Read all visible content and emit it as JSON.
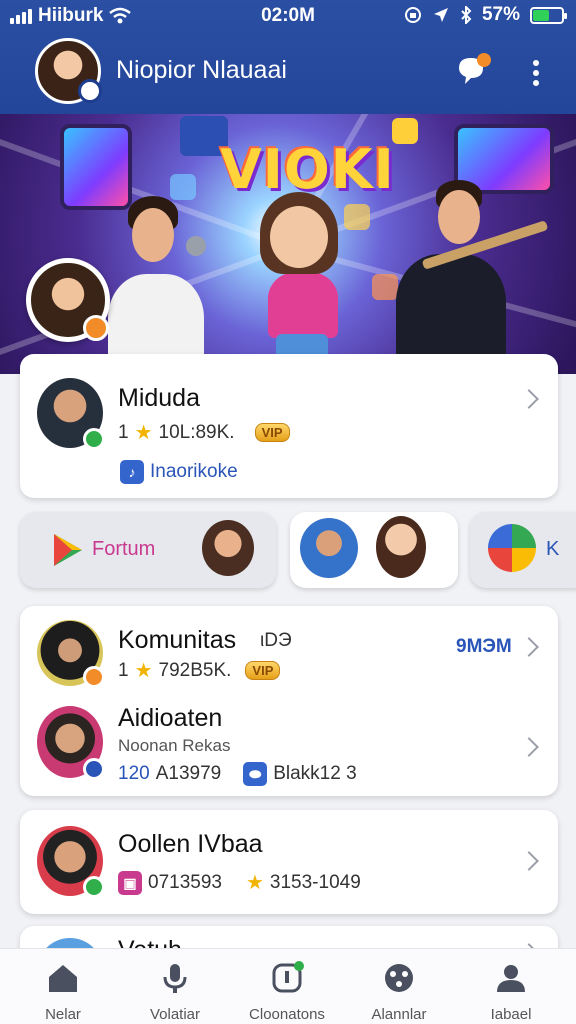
{
  "status_bar": {
    "carrier": "Hiiburk",
    "time": "02:0M",
    "battery": "57%",
    "icons": [
      "signal-icon",
      "wifi-icon",
      "rotation-lock-icon",
      "location-icon",
      "bluetooth-icon",
      "battery-icon"
    ]
  },
  "header": {
    "title": "Niopior Nlauaai",
    "icons": [
      "chat-bubble-icon",
      "more-vert-icon"
    ]
  },
  "banner": {
    "title": "VIOKI"
  },
  "featured": {
    "name": "Miduda",
    "stat": "1",
    "stat_value": "10L:89K.",
    "vip": "VIP",
    "tag": "Inaorikoke"
  },
  "chips": [
    {
      "label": "Fortum",
      "icon": "play-store-icon"
    },
    {
      "label": ""
    },
    {
      "label": "K",
      "icon": "play-store-icon"
    }
  ],
  "list_card_1": {
    "items": [
      {
        "name": "Komunitas",
        "suffix": "ιDЭ",
        "stat": "1",
        "stat_value": "792B5K.",
        "vip": "VIP",
        "right_label": "9MЭM"
      },
      {
        "name": "Aidioaten",
        "subtitle": "Noonan Rekas",
        "count": "120",
        "count_value": "A13979",
        "tag_value": "Blakk12 3"
      }
    ]
  },
  "list_card_2": {
    "name": "Oollen IVbaa",
    "phone": "0713593",
    "rating": "3153-1049"
  },
  "partial_card": {
    "name": "Vetuh"
  },
  "bottom_nav": [
    {
      "label": "Nelar",
      "icon": "home-icon"
    },
    {
      "label": "Volatiar",
      "icon": "microphone-icon"
    },
    {
      "label": "Cloonatons",
      "icon": "bell-icon"
    },
    {
      "label": "Alannlar",
      "icon": "game-controller-icon"
    },
    {
      "label": "Iabael",
      "icon": "profile-icon"
    }
  ],
  "colors": {
    "header_blue": "#2a4fa3",
    "accent_blue": "#2a55b8",
    "vip_gold": "#e6a019",
    "online_green": "#2fae4a",
    "accent_orange": "#f28c28"
  }
}
